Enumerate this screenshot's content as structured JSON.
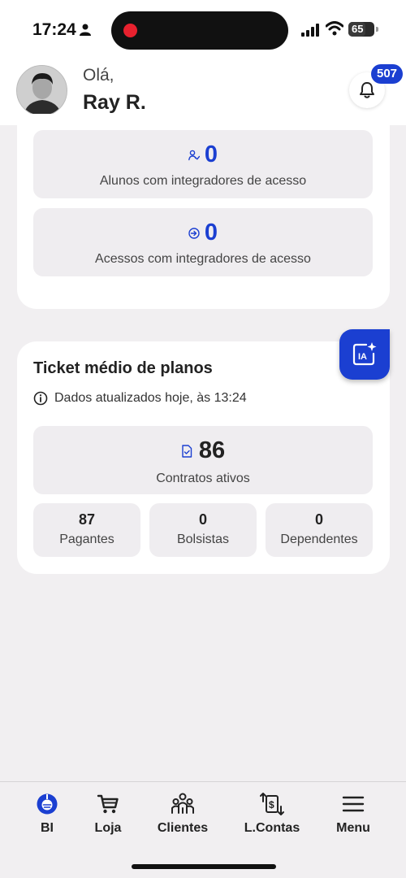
{
  "status_bar": {
    "time": "17:24",
    "battery": "65",
    "battery_level": 0.65
  },
  "header": {
    "greeting": "Olá,",
    "user_name": "Ray R.",
    "notification_count": "507"
  },
  "integrators": {
    "students": {
      "value": "0",
      "label": "Alunos com integradores de acesso"
    },
    "accesses": {
      "value": "0",
      "label": "Acessos com integradores de acesso"
    }
  },
  "ticket": {
    "title": "Ticket médio de planos",
    "updated": "Dados atualizados hoje, às 13:24",
    "contracts": {
      "value": "86",
      "label": "Contratos ativos"
    },
    "stats": [
      {
        "value": "87",
        "label": "Pagantes"
      },
      {
        "value": "0",
        "label": "Bolsistas"
      },
      {
        "value": "0",
        "label": "Dependentes"
      }
    ]
  },
  "ia_button": {
    "label": "IA"
  },
  "nav": {
    "items": [
      {
        "label": "BI",
        "icon": "bi-icon"
      },
      {
        "label": "Loja",
        "icon": "cart-icon"
      },
      {
        "label": "Clientes",
        "icon": "people-icon"
      },
      {
        "label": "L.Contas",
        "icon": "accounts-icon"
      },
      {
        "label": "Menu",
        "icon": "hamburger-icon"
      }
    ]
  },
  "colors": {
    "accent": "#1b3fd1",
    "background": "#f1eff1",
    "card": "#ffffff",
    "box": "#efedf0"
  }
}
